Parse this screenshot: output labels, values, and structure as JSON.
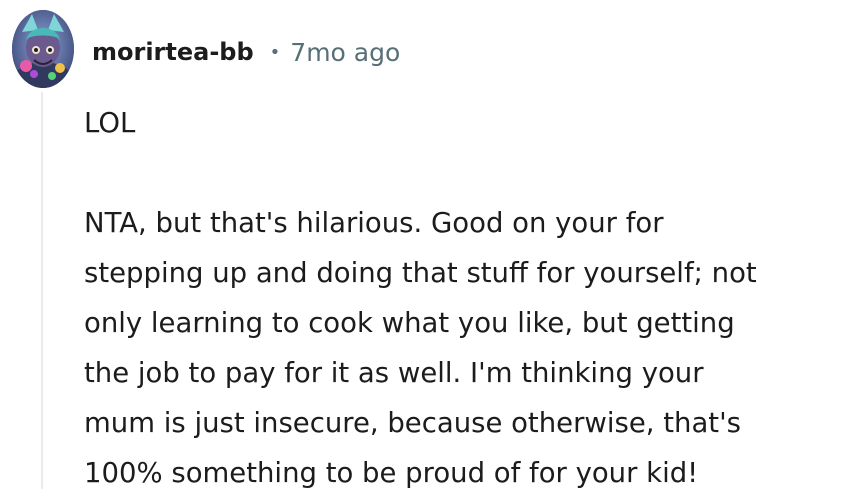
{
  "comment": {
    "username": "morirtea-bb",
    "separator": "•",
    "timestamp": "7mo ago",
    "avatar_icon": "user-avatar-icon",
    "paragraphs": [
      [
        "LOL"
      ],
      [
        "NTA, but that's hilarious. Good on your for",
        "stepping up and doing that stuff for yourself; not",
        "only learning to cook what you like, but getting",
        "the job to pay for it as well. I'm thinking your",
        "mum is just insecure, because otherwise, that's",
        "100% something to be proud of for your kid!"
      ]
    ]
  },
  "colors": {
    "username": "#1c1c1c",
    "meta": "#576f76",
    "thread_line": "#e5ebee",
    "body": "#1c1c1c"
  }
}
